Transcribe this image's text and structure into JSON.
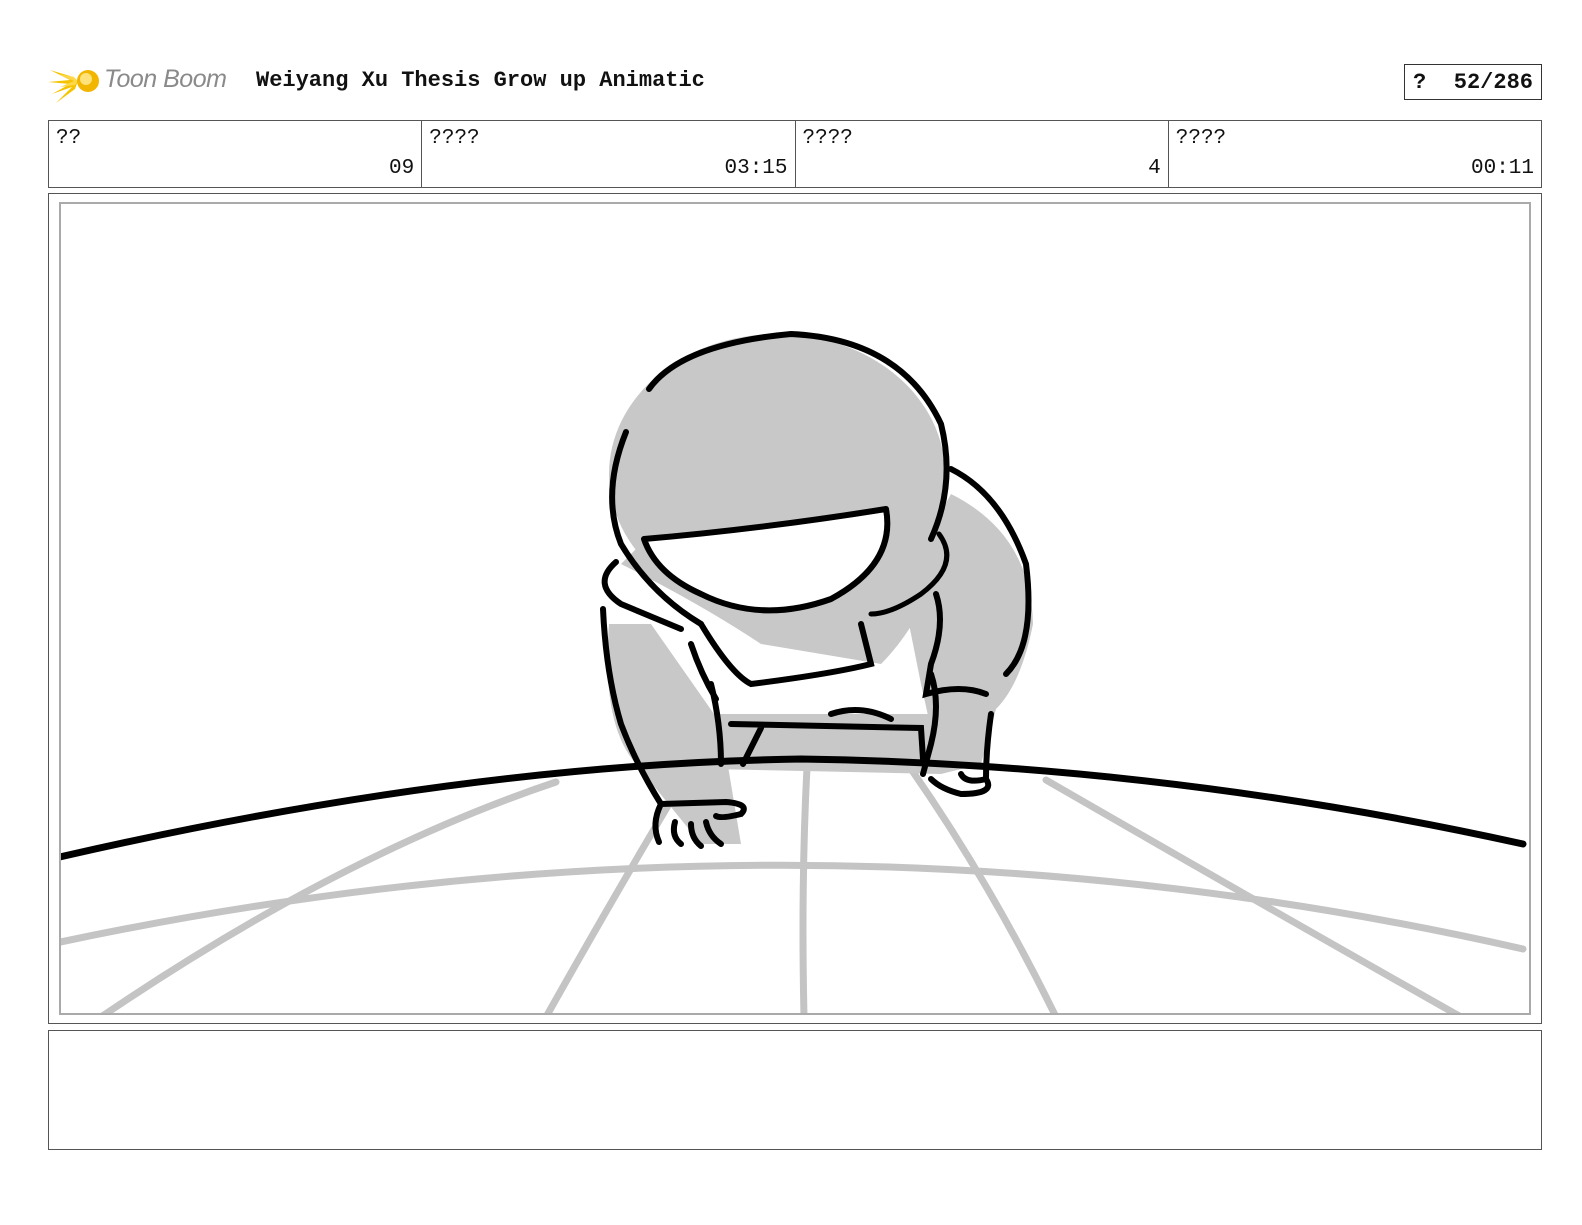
{
  "header": {
    "logo_text": "Toon Boom",
    "title": "Weiyang Xu Thesis Grow up Animatic",
    "page_marker": "?",
    "page_number": "52/286"
  },
  "info": [
    {
      "label": "??",
      "value": "09"
    },
    {
      "label": "????",
      "value": "03:15"
    },
    {
      "label": "????",
      "value": "4"
    },
    {
      "label": "????",
      "value": "00:11"
    }
  ],
  "notes": {
    "text": ""
  },
  "colors": {
    "logo_accent": "#f5c400",
    "sketch_fill": "#c8c8c8",
    "grid_line": "#c4c4c4"
  }
}
